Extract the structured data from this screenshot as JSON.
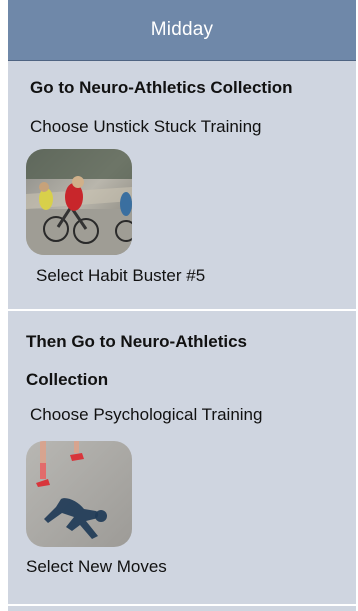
{
  "header": {
    "title": "Midday"
  },
  "section1": {
    "heading": "Go to Neuro-Athletics Collection",
    "instruction": "Choose Unstick Stuck Training",
    "action": "Select Habit Buster #5"
  },
  "section2": {
    "heading_line1": "Then Go to Neuro-Athletics",
    "heading_line2": "Collection",
    "instruction": "Choose Psychological Training",
    "action": "Select New Moves"
  },
  "colors": {
    "header_bg": "#6f88a9",
    "panel_bg": "#cfd5e0",
    "divider": "#ffffff"
  },
  "icons": {
    "thumb1": "cyclists-race-image",
    "thumb2": "runner-shadow-image"
  }
}
